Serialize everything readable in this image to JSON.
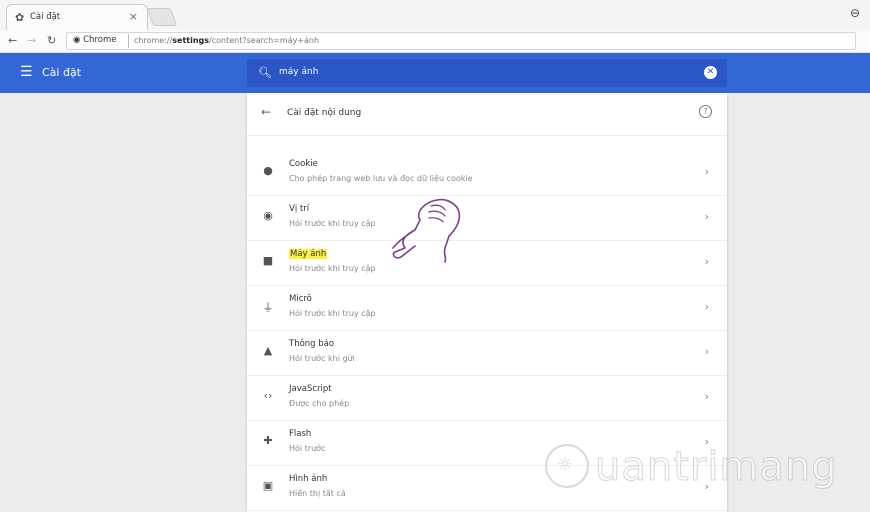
{
  "browser": {
    "tab_title": "Cài đặt",
    "url_chip": "Chrome",
    "url_prefix": "chrome://",
    "url_bold": "settings",
    "url_rest": "/content?search=máy+ảnh"
  },
  "appbar": {
    "title": "Cài đặt",
    "search_value": "máy ảnh"
  },
  "card": {
    "title": "Cài đặt nội dung",
    "items": [
      {
        "icon": "cookie-icon",
        "title": "Cookie",
        "subtitle": "Cho phép trang web lưu và đọc dữ liệu cookie"
      },
      {
        "icon": "location-icon",
        "title": "Vị trí",
        "subtitle": "Hỏi trước khi truy cập"
      },
      {
        "icon": "camera-icon",
        "title": "Máy ảnh",
        "subtitle": "Hỏi trước khi truy cập"
      },
      {
        "icon": "microphone-icon",
        "title": "Micrô",
        "subtitle": "Hỏi trước khi truy cập"
      },
      {
        "icon": "bell-icon",
        "title": "Thông báo",
        "subtitle": "Hỏi trước khi gửi"
      },
      {
        "icon": "code-icon",
        "title": "JavaScript",
        "subtitle": "Được cho phép"
      },
      {
        "icon": "puzzle-icon",
        "title": "Flash",
        "subtitle": "Hỏi trước"
      },
      {
        "icon": "image-icon",
        "title": "Hình ảnh",
        "subtitle": "Hiển thị tất cả"
      }
    ]
  },
  "watermark": {
    "text": "uantrimang"
  },
  "colors": {
    "appbar": "#3367d6",
    "search": "#2a56c6",
    "highlight": "#ffef40",
    "hand": "#7b3f8c"
  }
}
